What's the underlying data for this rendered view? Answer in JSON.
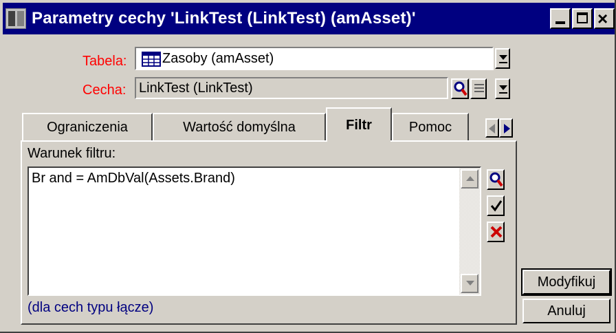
{
  "window": {
    "title": "Parametry cechy 'LinkTest (LinkTest) (amAsset)'"
  },
  "form": {
    "tabela_label": "Tabela:",
    "tabela_value": "Zasoby (amAsset)",
    "cecha_label": "Cecha:",
    "cecha_value": "LinkTest (LinkTest)"
  },
  "tabs": [
    {
      "label": "Ograniczenia",
      "mnemonic": "O"
    },
    {
      "label": "Wartość domyślna",
      "mnemonic": "W"
    },
    {
      "label": "Filtr",
      "mnemonic": "F",
      "active": true
    },
    {
      "label": "Pomoc",
      "mnemonic": "c"
    }
  ],
  "filter": {
    "label": "Warunek filtru:",
    "value": "Br and = AmDbVal(Assets.Brand)",
    "hint": "(dla cech typu łącze)"
  },
  "buttons": {
    "modify": "Modyfikuj",
    "cancel": "Anuluj"
  },
  "colors": {
    "titlebar": "#000080",
    "label_red": "#ff0000",
    "hint_blue": "#000080",
    "face": "#d4d0c8"
  },
  "icons": [
    "app-icon",
    "minimize-icon",
    "maximize-icon",
    "close-icon",
    "table-icon",
    "dropdown-arrow-icon",
    "magnifier-icon",
    "list-icon",
    "tab-scroll-left-icon",
    "tab-scroll-right-icon",
    "checkmark-icon",
    "delete-x-icon"
  ]
}
